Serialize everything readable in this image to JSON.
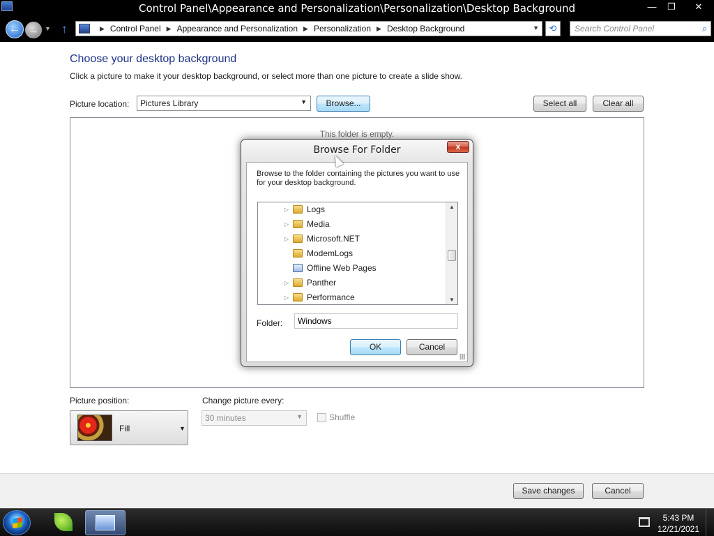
{
  "window": {
    "title": "Control Panel\\Appearance and Personalization\\Personalization\\Desktop Background",
    "minimize": "—",
    "maximize": "❐",
    "close": "✕"
  },
  "nav": {
    "back_glyph": "←",
    "forward_glyph": "→",
    "up_glyph": "↑",
    "breadcrumbs": [
      "Control Panel",
      "Appearance and Personalization",
      "Personalization",
      "Desktop Background"
    ],
    "crumb_separator": "▶",
    "refresh_glyph": "⟲",
    "search_placeholder": "Search Control Panel"
  },
  "main": {
    "heading": "Choose your desktop background",
    "instruction": "Click a picture to make it your desktop background, or select more than one picture to create a slide show.",
    "picture_location_label": "Picture location:",
    "picture_location_value": "Pictures Library",
    "browse_label": "Browse...",
    "select_all_label": "Select all",
    "clear_all_label": "Clear all",
    "empty_message": "This folder is empty.",
    "picture_position_label": "Picture position:",
    "picture_position_value": "Fill",
    "change_every_label": "Change picture every:",
    "change_every_value": "30 minutes",
    "shuffle_label": "Shuffle",
    "shuffle_checked": false,
    "save_label": "Save changes",
    "cancel_label": "Cancel"
  },
  "dialog": {
    "title": "Browse For Folder",
    "close_glyph": "x",
    "description": "Browse to the folder containing the pictures you want to use for your desktop background.",
    "tree_items": [
      {
        "label": "Logs",
        "expandable": true,
        "icon": "folder-icon"
      },
      {
        "label": "Media",
        "expandable": true,
        "icon": "folder-icon"
      },
      {
        "label": "Microsoft.NET",
        "expandable": true,
        "icon": "folder-icon"
      },
      {
        "label": "ModemLogs",
        "expandable": false,
        "icon": "folder-icon"
      },
      {
        "label": "Offline Web Pages",
        "expandable": false,
        "icon": "offline-web-pages-icon"
      },
      {
        "label": "Panther",
        "expandable": true,
        "icon": "folder-icon"
      },
      {
        "label": "Performance",
        "expandable": true,
        "icon": "folder-icon"
      }
    ],
    "folder_label": "Folder:",
    "folder_value": "Windows",
    "ok_label": "OK",
    "cancel_label": "Cancel"
  },
  "taskbar": {
    "time": "5:43 PM",
    "date": "12/21/2021"
  }
}
